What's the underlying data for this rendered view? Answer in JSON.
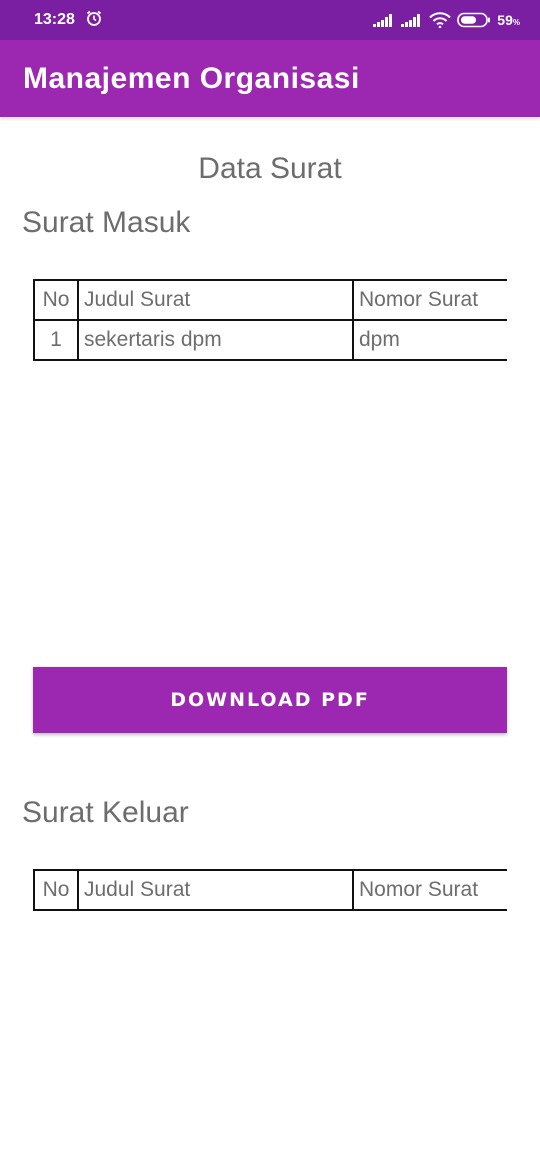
{
  "status_bar": {
    "time": "13:28",
    "battery_level": "59",
    "battery_unit": "%",
    "icons": [
      "alarm-icon",
      "signal-icon",
      "signal-icon",
      "wifi-icon",
      "battery-icon"
    ]
  },
  "app_bar": {
    "title": "Manajemen Organisasi"
  },
  "page": {
    "heading": "Data Surat"
  },
  "surat_masuk": {
    "title": "Surat Masuk",
    "headers": {
      "no": "No",
      "judul": "Judul Surat",
      "nomor": "Nomor Surat"
    },
    "rows": [
      {
        "no": "1",
        "judul": "sekertaris dpm",
        "nomor": "dpm"
      }
    ]
  },
  "download_button": {
    "label": "Download PDF"
  },
  "surat_keluar": {
    "title": "Surat Keluar",
    "headers": {
      "no": "No",
      "judul": "Judul Surat",
      "nomor": "Nomor Surat"
    }
  },
  "colors": {
    "status_bar": "#7b1fa2",
    "app_bar": "#9c27b0",
    "button": "#9c27b0",
    "text": "#6d6d6d"
  }
}
